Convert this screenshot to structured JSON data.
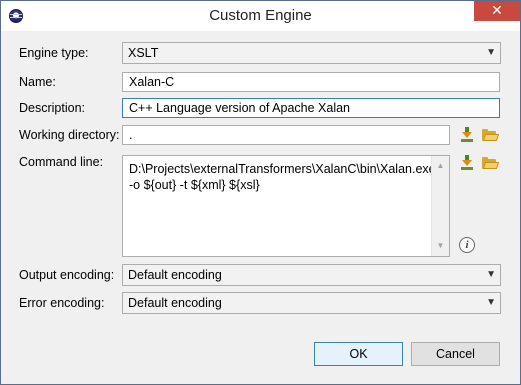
{
  "window": {
    "title": "Custom Engine",
    "close_glyph": "✕",
    "app_icon": "eclipse-icon"
  },
  "form": {
    "engine_type": {
      "label": "Engine type:",
      "value": "XSLT"
    },
    "name": {
      "label": "Name:",
      "value": "Xalan-C"
    },
    "description": {
      "label": "Description:",
      "value": "C++ Language version of Apache Xalan"
    },
    "working_directory": {
      "label": "Working directory:",
      "value": "."
    },
    "command_line": {
      "label": "Command line:",
      "lines": [
        "D:\\Projects\\externalTransformers\\XalanC\\bin\\Xalan.exe",
        "-o ${out} -t ${xml} ${xsl}"
      ]
    },
    "output_encoding": {
      "label": "Output encoding:",
      "value": "Default encoding"
    },
    "error_encoding": {
      "label": "Error encoding:",
      "value": "Default encoding"
    }
  },
  "icons": {
    "insert_variable": "download-arrow-icon",
    "browse": "folder-open-icon",
    "info": "info-icon",
    "info_glyph": "i",
    "dropdown_glyph": "▼",
    "scroll_up_glyph": "▲",
    "scroll_down_glyph": "▼"
  },
  "buttons": {
    "ok": "OK",
    "cancel": "Cancel"
  },
  "colors": {
    "close_button": "#c7493f",
    "focus_border": "#3c7fb1",
    "dialog_background": "#f0f0f0"
  }
}
